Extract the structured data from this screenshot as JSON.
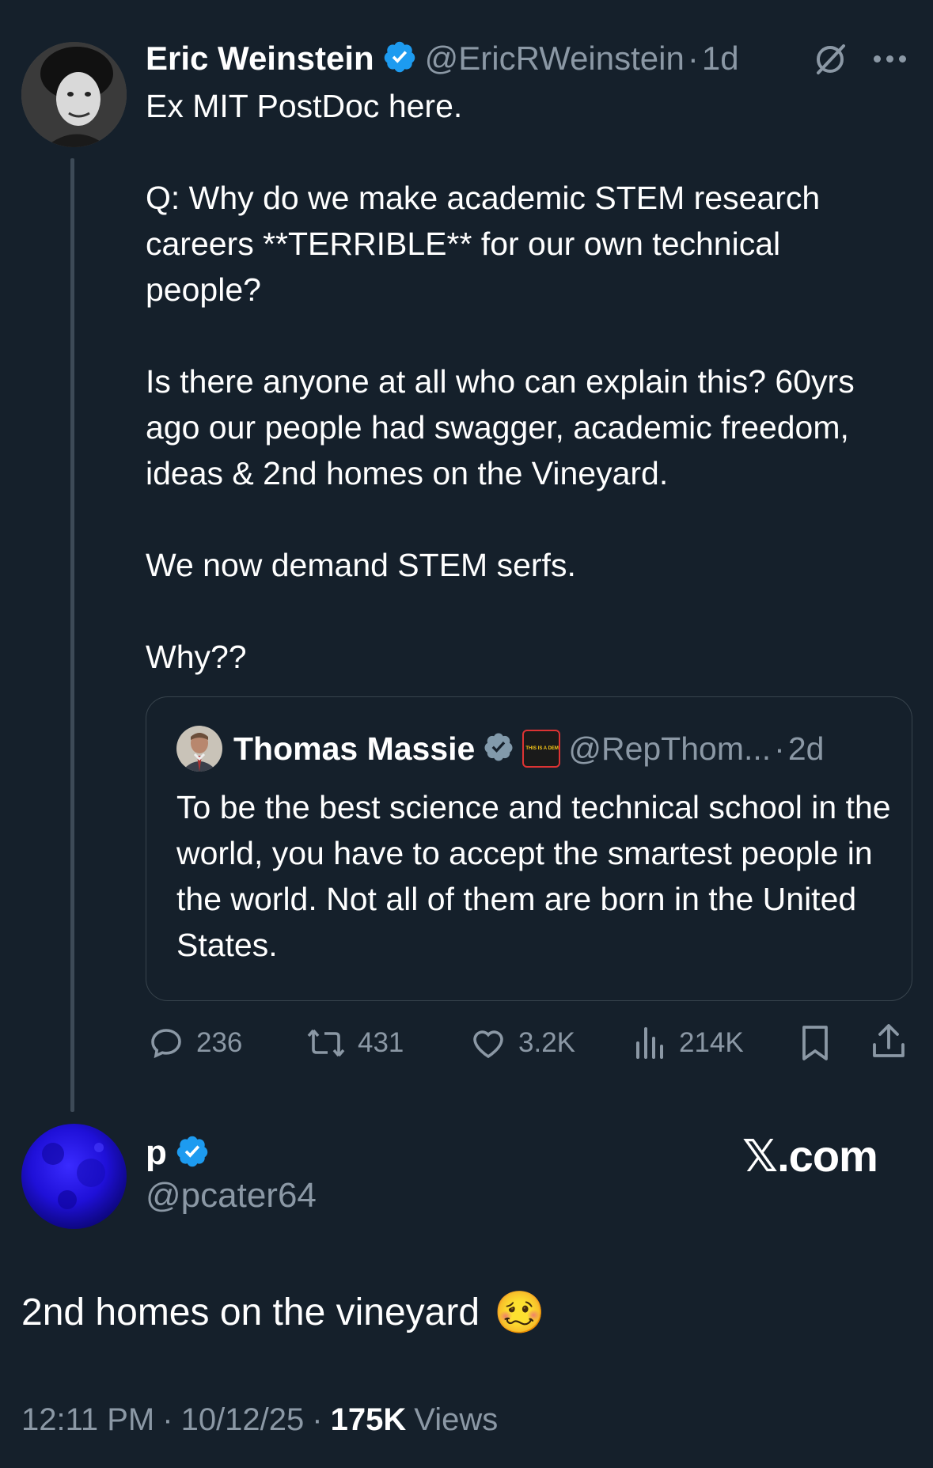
{
  "main_tweet": {
    "author_name": "Eric Weinstein",
    "handle": "@EricRWeinstein",
    "time": "1d",
    "separator": "·",
    "text": "Ex MIT PostDoc here.\n\nQ: Why do we make academic STEM research careers **TERRIBLE** for our own technical people?\n\nIs there anyone at all who can explain this? 60yrs ago our people had swagger, academic freedom, ideas & 2nd homes on the Vineyard.\n\nWe now demand STEM serfs.\n\nWhy??",
    "quoted": {
      "author_name": "Thomas Massie",
      "handle": "@RepThom...",
      "time": "2d",
      "badge_text": "THIS IS A DEMOCRAT",
      "text": "To be the best science and technical school in the world, you have to accept the smartest people in the world. Not all of them are born in the United States."
    },
    "stats": {
      "replies": "236",
      "reposts": "431",
      "likes": "3.2K",
      "views": "214K"
    }
  },
  "reply": {
    "author_name": "p",
    "handle": "@pcater64",
    "watermark": "𝕏.com",
    "text": "2nd homes on the vineyard",
    "emoji": "🥴",
    "time": "12:11 PM",
    "date": "10/12/25",
    "views_count": "175K",
    "views_label": "Views",
    "separator": "·"
  },
  "colors": {
    "background": "#15202b",
    "verified_blue": "#1d9bf0",
    "verified_gray": "#829aab",
    "muted": "#8b98a5"
  }
}
